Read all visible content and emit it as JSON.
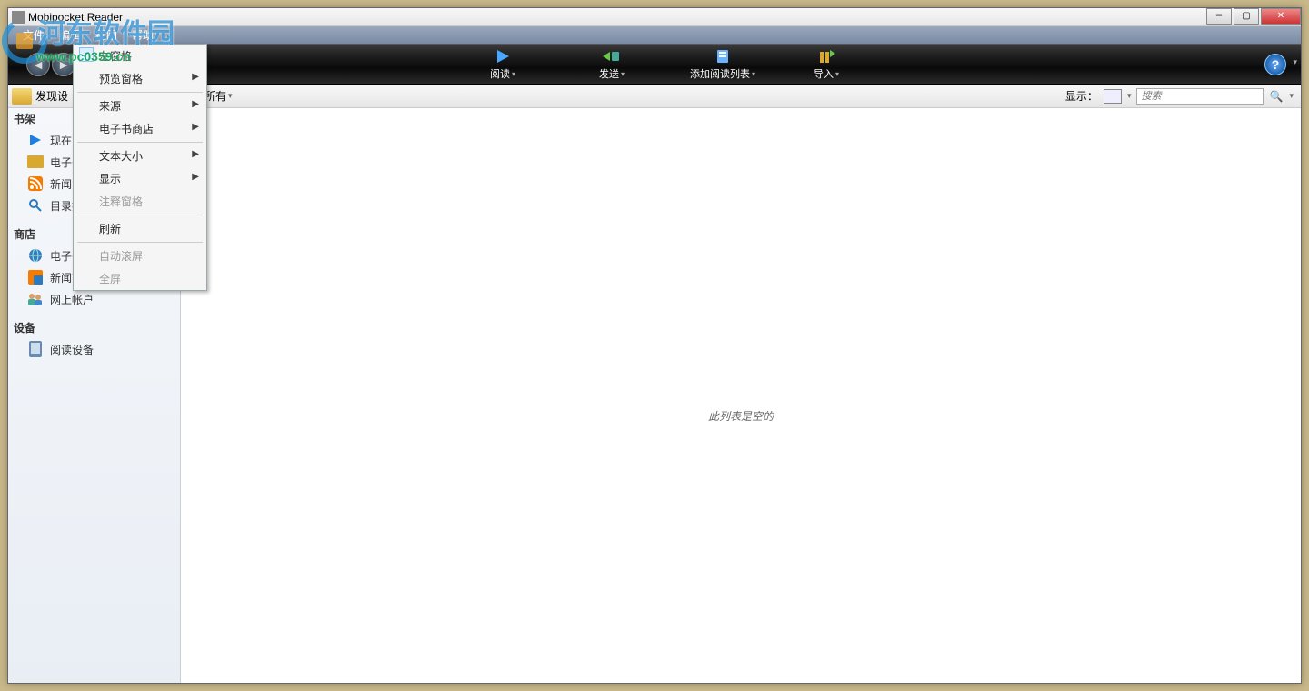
{
  "window": {
    "title": "Mobipocket Reader"
  },
  "watermark": {
    "text": "河东软件园",
    "url": "www.pc0359.cn"
  },
  "menubar": {
    "items": [
      "文件",
      "编辑",
      "视图",
      "帮助"
    ]
  },
  "toolbar": {
    "read": "阅读",
    "send": "发送",
    "addlist": "添加阅读列表",
    "import": "导入"
  },
  "filterbar": {
    "found": "发现设",
    "filter": "所有",
    "show_label": "显示：",
    "search_placeholder": "搜索"
  },
  "sidebar": {
    "bookshelf_hdr": "书架",
    "now_reading": "现在阅",
    "ebook": "电子书",
    "news": "新闻",
    "catalog": "目录搜",
    "store_hdr": "商店",
    "ebook_store_s": "电子书",
    "news_store": "新闻商店",
    "online_account": "网上帐户",
    "device_hdr": "设备",
    "reading_device": "阅读设备"
  },
  "dropdown": {
    "left_pane": "左窗格",
    "preview_pane": "预览窗格",
    "source": "来源",
    "ebook_store": "电子书商店",
    "text_size": "文本大小",
    "display": "显示",
    "annotation_pane": "注释窗格",
    "refresh": "刷新",
    "auto_scroll": "自动滚屏",
    "fullscreen": "全屏"
  },
  "content": {
    "empty": "此列表是空的"
  }
}
